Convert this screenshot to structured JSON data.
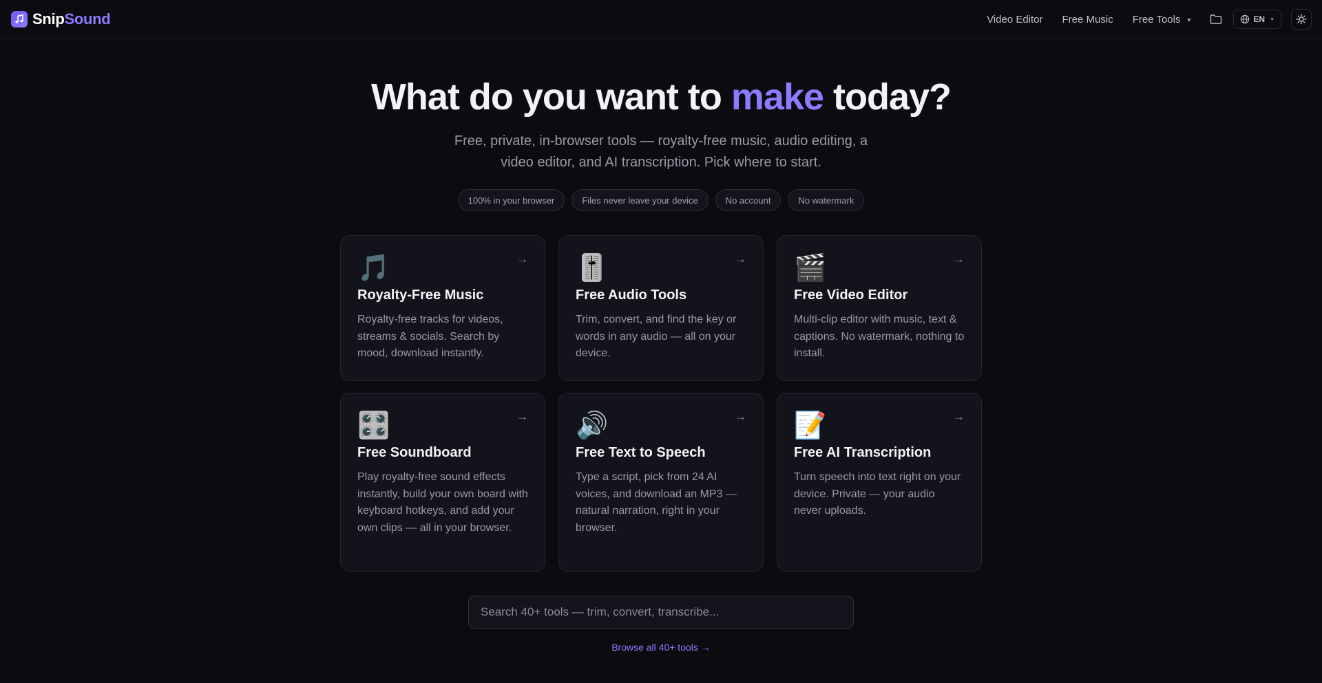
{
  "header": {
    "brand_part1": "Snip",
    "brand_part2": "Sound",
    "nav": [
      {
        "label": "Video Editor"
      },
      {
        "label": "Free Music"
      },
      {
        "label": "Free Tools"
      }
    ],
    "lang": "EN"
  },
  "hero": {
    "title_pre": "What do you want to ",
    "title_accent": "make",
    "title_post": " today?",
    "subtitle": "Free, private, in-browser tools — royalty-free music, audio editing, a video editor, and AI transcription. Pick where to start.",
    "pills": [
      "100% in your browser",
      "Files never leave your device",
      "No account",
      "No watermark"
    ]
  },
  "cards": [
    {
      "icon": "🎵",
      "title": "Royalty-Free Music",
      "desc": "Royalty-free tracks for videos, streams & socials. Search by mood, download instantly."
    },
    {
      "icon": "🎚️",
      "title": "Free Audio Tools",
      "desc": "Trim, convert, and find the key or words in any audio — all on your device."
    },
    {
      "icon": "🎬",
      "title": "Free Video Editor",
      "desc": "Multi-clip editor with music, text & captions. No watermark, nothing to install."
    },
    {
      "icon": "🎛️",
      "title": "Free Soundboard",
      "desc": "Play royalty-free sound effects instantly, build your own board with keyboard hotkeys, and add your own clips — all in your browser."
    },
    {
      "icon": "🔊",
      "title": "Free Text to Speech",
      "desc": "Type a script, pick from 24 AI voices, and download an MP3 — natural narration, right in your browser."
    },
    {
      "icon": "📝",
      "title": "Free AI Transcription",
      "desc": "Turn speech into text right on your device. Private — your audio never uploads."
    }
  ],
  "card_arrow": "→",
  "search": {
    "placeholder": "Search 40+ tools — trim, convert, transcribe..."
  },
  "browse_link": "Browse all 40+ tools →",
  "colors": {
    "accent": "#8b7bff",
    "background": "#0b0b10",
    "card": "#13131b"
  }
}
